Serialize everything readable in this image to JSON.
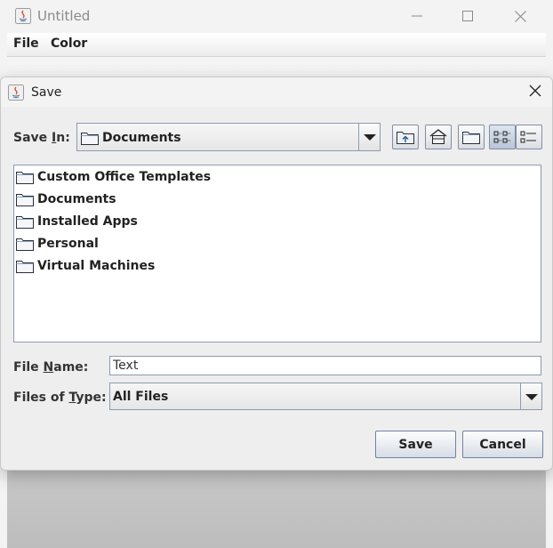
{
  "window": {
    "title": "Untitled",
    "menu": [
      {
        "label": "File"
      },
      {
        "label": "Color"
      }
    ]
  },
  "dialog": {
    "title": "Save",
    "save_in_label_pre": "Save ",
    "save_in_label_mn": "I",
    "save_in_label_post": "n:",
    "save_in_value": "Documents",
    "toolbar": [
      "up-one-level",
      "home",
      "new-folder",
      "list-view",
      "details-view"
    ],
    "files": [
      {
        "name": "Custom Office Templates"
      },
      {
        "name": "Documents"
      },
      {
        "name": "Installed Apps"
      },
      {
        "name": "Personal"
      },
      {
        "name": "Virtual Machines"
      }
    ],
    "file_name_label_pre": "File ",
    "file_name_label_mn": "N",
    "file_name_label_post": "ame:",
    "file_name_value": "Text",
    "file_type_label_pre": "Files of ",
    "file_type_label_mn": "T",
    "file_type_label_post": "ype:",
    "file_type_value": "All Files",
    "save_button": "Save",
    "cancel_button": "Cancel"
  },
  "colors": {
    "border": "#8d9ab0",
    "dialog_bg": "#eeeeee",
    "list_bg": "#ffffff"
  }
}
